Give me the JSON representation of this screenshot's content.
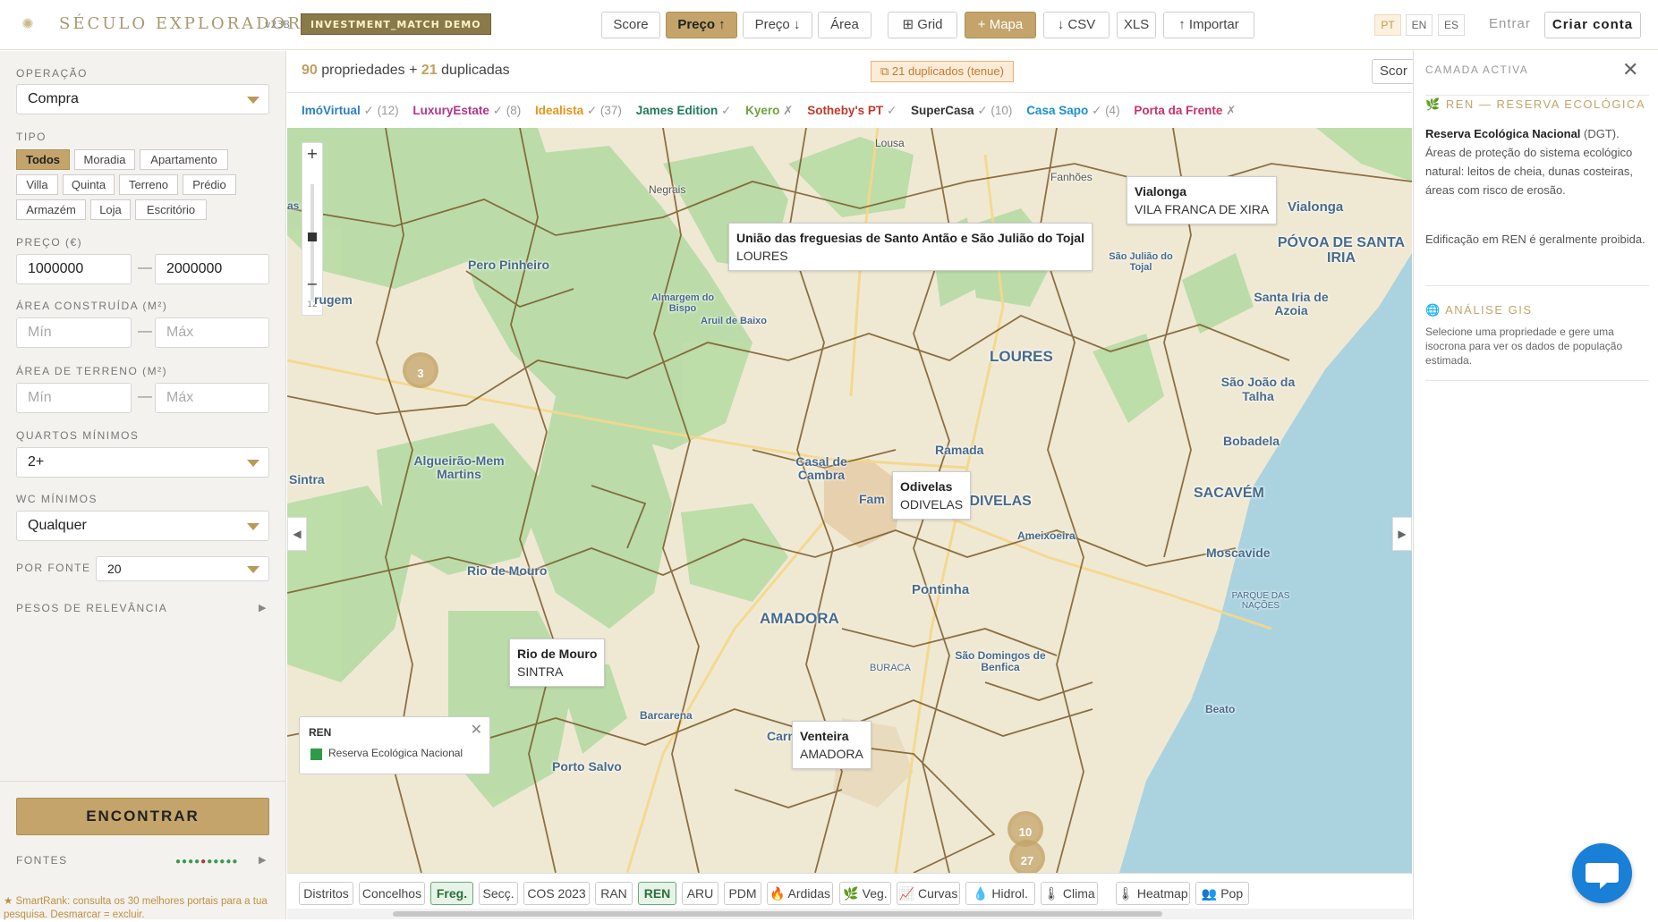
{
  "header": {
    "logo_icon": "sun-logo-icon",
    "brand": "SÉCULO EXPLORADOR",
    "version": "v23B",
    "demo_badge": "INVESTMENT_MATCH DEMO",
    "sort_buttons": [
      "Score",
      "Preço ↑",
      "Preço ↓",
      "Área"
    ],
    "view_buttons": [
      "⊞ Grid",
      "+ Mapa"
    ],
    "export_buttons": [
      "↓ CSV",
      "XLS",
      "↑ Importar"
    ],
    "languages": [
      "PT",
      "EN",
      "ES"
    ],
    "login": "Entrar",
    "signup": "Criar conta"
  },
  "sidebar": {
    "operacao_label": "OPERAÇÃO",
    "operacao_value": "Compra",
    "tipo_label": "TIPO",
    "tipos": [
      "Todos",
      "Moradia",
      "Apartamento",
      "Villa",
      "Quinta",
      "Terreno",
      "Prédio",
      "Armazém",
      "Loja",
      "Escritório"
    ],
    "preco_label": "PREÇO (€)",
    "preco_min": "1000000",
    "preco_max": "2000000",
    "area_construida_label": "ÁREA CONSTRUÍDA (M²)",
    "area_terreno_label": "ÁREA DE TERRENO (M²)",
    "min_placeholder": "Mín",
    "max_placeholder": "Máx",
    "quartos_label": "QUARTOS MÍNIMOS",
    "quartos_value": "2+",
    "wc_label": "WC MÍNIMOS",
    "wc_value": "Qualquer",
    "por_fonte_label": "POR FONTE",
    "por_fonte_value": "20",
    "pesos_label": "PESOS DE RELEVÂNCIA",
    "encontrar": "ENCONTRAR",
    "fontes_label": "FONTES",
    "smartrank": "★ SmartRank: consulta os 30 melhores portais para a tua pesquisa. Desmarcar = excluir."
  },
  "results": {
    "count": "90",
    "count_label": "propriedades +",
    "dup_count": "21",
    "dup_label": "duplicadas",
    "dup_badge": "⧉ 21 duplicados (tenue)",
    "sort_cut": "Scor"
  },
  "sources": [
    {
      "name": "ImóVirtual",
      "mark": "✓",
      "count": "(12)",
      "color": "#2a7fc4"
    },
    {
      "name": "LuxuryEstate",
      "mark": "✓",
      "count": "(8)",
      "color": "#b5338a"
    },
    {
      "name": "Idealista",
      "mark": "✓",
      "count": "(37)",
      "color": "#e8941a"
    },
    {
      "name": "James Edition",
      "mark": "✓",
      "count": "",
      "color": "#1f7a5a"
    },
    {
      "name": "Kyero",
      "mark": "✗",
      "count": "",
      "color": "#6ea33a"
    },
    {
      "name": "Sotheby's PT",
      "mark": "✓",
      "count": "",
      "color": "#c0392b"
    },
    {
      "name": "SuperCasa",
      "mark": "✓",
      "count": "(10)",
      "color": "#333333"
    },
    {
      "name": "Casa Sapo",
      "mark": "✓",
      "count": "(4)",
      "color": "#1a8fd0"
    },
    {
      "name": "Porta da Frente",
      "mark": "✗",
      "count": "",
      "color": "#c8326a"
    }
  ],
  "map": {
    "zoom_plus": "+",
    "zoom_minus": "−",
    "zoom_level": "12",
    "tooltips": [
      {
        "title": "União das freguesias de Santo Antão e São Julião do Tojal",
        "sub": "LOURES"
      },
      {
        "title": "Vialonga",
        "sub": "VILA FRANCA DE XIRA"
      },
      {
        "title": "Odivelas",
        "sub": "ODIVELAS"
      },
      {
        "title": "Rio de Mouro",
        "sub": "SINTRA"
      },
      {
        "title": "Venteira",
        "sub": "AMADORA"
      }
    ],
    "places": [
      "Lousa",
      "Fanhões",
      "Negrais",
      "Vialonga",
      "PÓVOA DE SANTA IRIA",
      "Pero Pinheiro",
      "São Julião do Tojal",
      "Almargem do Bispo",
      "Aruil de Baixo",
      "rugem",
      "Santa Iria de Azoia",
      "LOURES",
      "São João da Talha",
      "Bobadela",
      "Ramada",
      "Casal de Cambra",
      "Sintra",
      "Algueirão-Mem Martins",
      "ODIVELAS",
      "SACAVÉM",
      "Ameixoeira",
      "Moscavide",
      "Rio de Mouro",
      "Pontinha",
      "AMADORA",
      "PARQUE DAS NAÇÕES",
      "São Domingos de Benfica",
      "Barcarena",
      "Carnaxide",
      "Beato",
      "Porto Salvo",
      "as",
      "Fam",
      "BURACA"
    ],
    "legend_title": "REN",
    "legend_item": "Reserva Ecológica Nacional",
    "clusters": [
      "3",
      "10",
      "27"
    ]
  },
  "layers": [
    "Distritos",
    "Concelhos",
    "Freg.",
    "Secç.",
    "COS 2023",
    "RAN",
    "REN",
    "ARU",
    "PDM",
    "🔥 Ardidas",
    "🌿 Veg.",
    "📈 Curvas",
    "💧 Hidrol.",
    "🌡 Clima",
    "🌡 Heatmap",
    "👥 Pop"
  ],
  "right_panel": {
    "title": "CAMADA ACTIVA",
    "ren_title": "REN — RESERVA ECOLÓGICA",
    "ren_bold": "Reserva Ecológica Nacional",
    "ren_src": " (DGT).",
    "ren_desc": "Áreas de proteção do sistema ecológico natural: leitos de cheia, dunas costeiras, áreas com risco de erosão.",
    "ren_note": "Edificação em REN é geralmente proibida.",
    "gis_title": "ANÁLISE GIS",
    "gis_desc": "Selecione uma propriedade e gere uma isocrona para ver os dados de população estimada."
  },
  "colors": {
    "accent": "#c4a46a",
    "ren_green": "#2e9a4a",
    "water": "#aad3df"
  }
}
